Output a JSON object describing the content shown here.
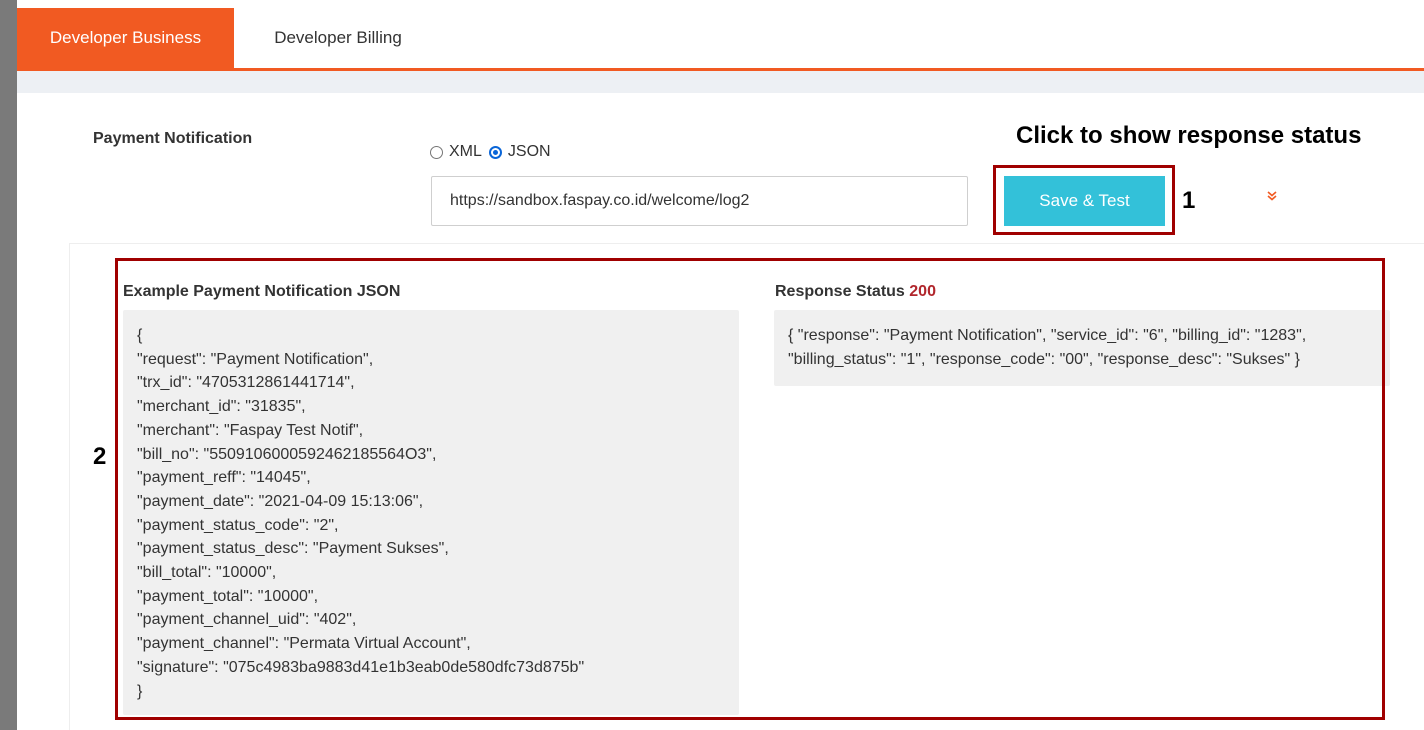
{
  "tabs": [
    {
      "label": "Developer Business",
      "active": true
    },
    {
      "label": "Developer Billing",
      "active": false
    }
  ],
  "payment_notification": {
    "label": "Payment Notification",
    "format_options": [
      {
        "label": "XML",
        "selected": false
      },
      {
        "label": "JSON",
        "selected": true
      }
    ],
    "url_value": "https://sandbox.faspay.co.id/welcome/log2",
    "save_button_label": "Save & Test"
  },
  "annotations": {
    "title": "Click to show response status",
    "step1": "1",
    "step2": "2"
  },
  "example": {
    "title": "Example Payment Notification JSON",
    "lines": [
      "{",
      "\"request\": \"Payment Notification\",",
      "\"trx_id\": \"4705312861441714\",",
      "\"merchant_id\": \"31835\",",
      "\"merchant\": \"Faspay Test Notif\",",
      "\"bill_no\": \"5509106000592462185564O3\",",
      "\"payment_reff\": \"14045\",",
      "\"payment_date\": \"2021-04-09 15:13:06\",",
      "\"payment_status_code\": \"2\",",
      "\"payment_status_desc\": \"Payment Sukses\",",
      "\"bill_total\": \"10000\",",
      "\"payment_total\": \"10000\",",
      "\"payment_channel_uid\": \"402\",",
      "\"payment_channel\": \"Permata Virtual Account\",",
      "\"signature\": \"075c4983ba9883d41e1b3eab0de580dfc73d875b\"",
      "}"
    ]
  },
  "response": {
    "title": "Response Status",
    "status_code": "200",
    "body": "{ \"response\": \"Payment Notification\", \"service_id\": \"6\", \"billing_id\": \"1283\", \"billing_status\": \"1\", \"response_code\": \"00\", \"response_desc\": \"Sukses\" }"
  },
  "colors": {
    "accent": "#f15a22",
    "button": "#33c1d9",
    "annotation_border": "#a00000",
    "status_code": "#b1262c"
  },
  "icons": {
    "expand": "chevron-double-down-icon"
  }
}
